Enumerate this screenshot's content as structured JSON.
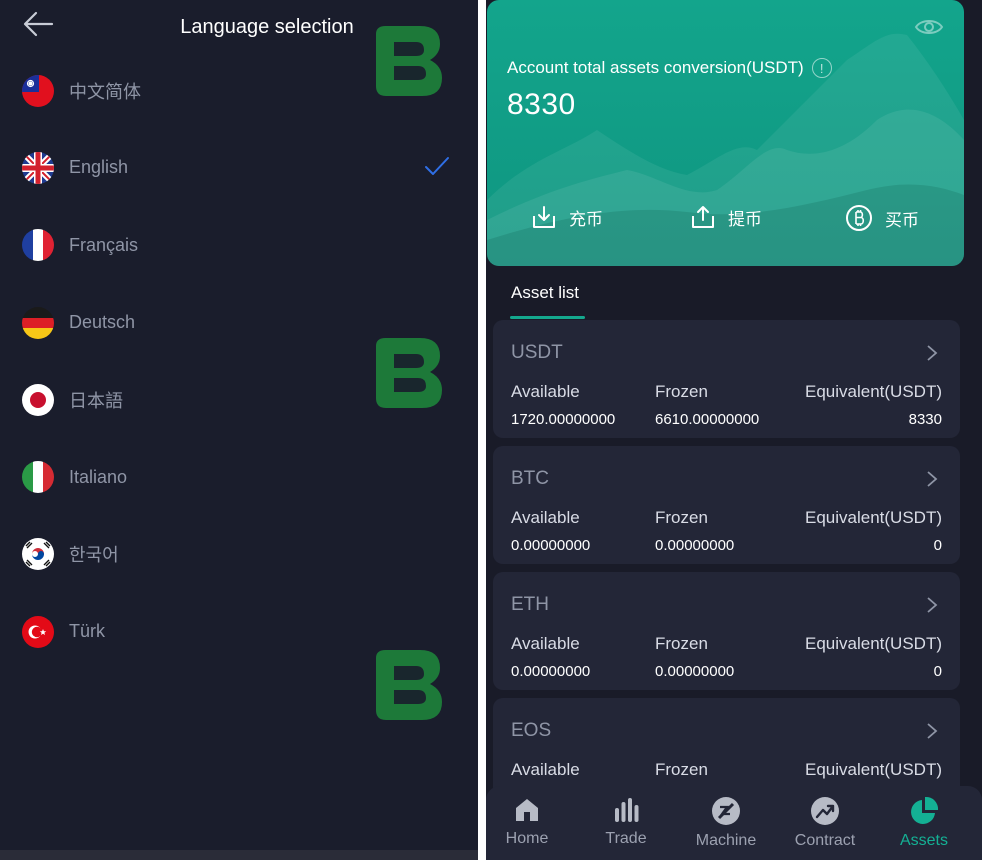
{
  "language_page": {
    "title": "Language selection",
    "languages": [
      {
        "label": "中文简体",
        "flag": "taiwan-flag",
        "selected": false
      },
      {
        "label": "English",
        "flag": "uk-flag",
        "selected": true
      },
      {
        "label": "Français",
        "flag": "france-flag",
        "selected": false
      },
      {
        "label": "Deutsch",
        "flag": "germany-flag",
        "selected": false
      },
      {
        "label": "日本語",
        "flag": "japan-flag",
        "selected": false
      },
      {
        "label": "Italiano",
        "flag": "italy-flag",
        "selected": false
      },
      {
        "label": "한국어",
        "flag": "korea-flag",
        "selected": false
      },
      {
        "label": "Türk",
        "flag": "turkey-flag",
        "selected": false
      }
    ],
    "check_color": "#2f6fe6"
  },
  "assets_page": {
    "summary": {
      "label": "Account total assets conversion(USDT)",
      "value": "8330",
      "actions": [
        {
          "label": "充币",
          "icon": "deposit-icon"
        },
        {
          "label": "提币",
          "icon": "withdraw-icon"
        },
        {
          "label": "买币",
          "icon": "bitcoin-icon"
        }
      ]
    },
    "tab_label": "Asset list",
    "columns": {
      "available": "Available",
      "frozen": "Frozen",
      "equivalent": "Equivalent(USDT)"
    },
    "assets": [
      {
        "name": "USDT",
        "available": "1720.00000000",
        "frozen": "6610.00000000",
        "equivalent": "8330"
      },
      {
        "name": "BTC",
        "available": "0.00000000",
        "frozen": "0.00000000",
        "equivalent": "0"
      },
      {
        "name": "ETH",
        "available": "0.00000000",
        "frozen": "0.00000000",
        "equivalent": "0"
      },
      {
        "name": "EOS",
        "available": "",
        "frozen": "",
        "equivalent": ""
      }
    ],
    "nav": [
      {
        "label": "Home",
        "icon": "home-icon",
        "active": false
      },
      {
        "label": "Trade",
        "icon": "trade-icon",
        "active": false
      },
      {
        "label": "Machine",
        "icon": "machine-icon",
        "active": false
      },
      {
        "label": "Contract",
        "icon": "contract-icon",
        "active": false
      },
      {
        "label": "Assets",
        "icon": "assets-pie-icon",
        "active": true
      }
    ],
    "accent_color": "#14a88e"
  }
}
